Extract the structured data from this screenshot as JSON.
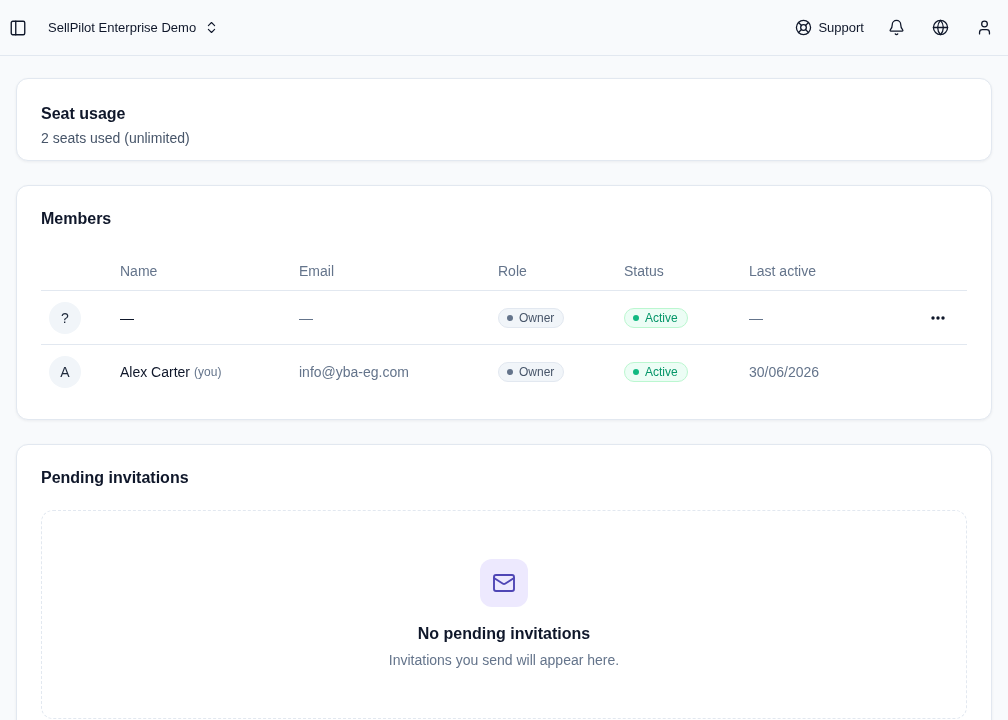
{
  "top_bar": {
    "workspace": "SellPilot Enterprise Demo",
    "support": "Support"
  },
  "seat_usage": {
    "title": "Seat usage",
    "summary": "2 seats used (unlimited)"
  },
  "members": {
    "title": "Members",
    "columns": [
      "Name",
      "Email",
      "Role",
      "Status",
      "Last active"
    ],
    "rows": [
      {
        "avatar": "?",
        "name": "—",
        "email": "—",
        "role": "Owner",
        "status": "Active",
        "last_active": "—",
        "menu": true
      },
      {
        "avatar": "A",
        "name": "Alex Carter",
        "you_tag": "(you)",
        "email": "info@yba-eg.com",
        "role": "Owner",
        "status": "Active",
        "last_active": "30/06/2026",
        "menu": false
      }
    ]
  },
  "pending_invitations": {
    "title": "Pending invitations",
    "empty_title": "No pending invitations",
    "empty_text": "Invitations you send will appear here."
  }
}
